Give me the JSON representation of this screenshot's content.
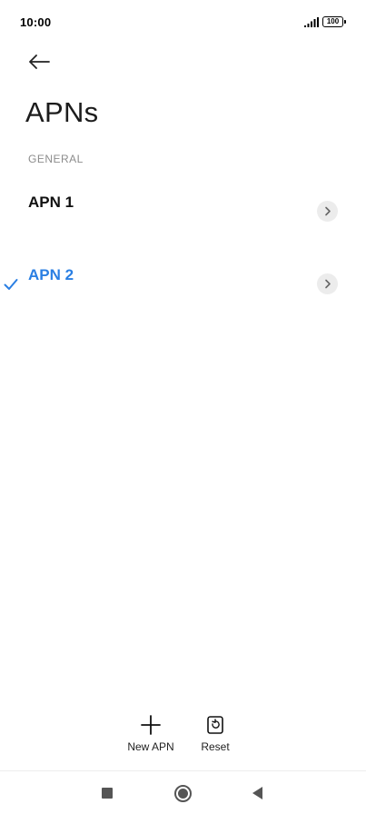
{
  "status_bar": {
    "time": "10:00",
    "battery": "100",
    "icons": [
      "signal-icon",
      "battery-icon"
    ]
  },
  "header": {
    "back_icon": "arrow-left-icon",
    "title": "APNs"
  },
  "sections": [
    {
      "header": "GENERAL",
      "items": [
        {
          "label": "APN 1",
          "selected": false
        },
        {
          "label": "APN 2",
          "selected": true
        }
      ]
    }
  ],
  "colors": {
    "accent": "#2a7fe3",
    "text_primary": "#111111",
    "text_secondary": "#8c8c8c",
    "chevron_bg": "#ececec"
  },
  "actions": {
    "new_apn_label": "New APN",
    "new_apn_icon": "plus-icon",
    "reset_label": "Reset",
    "reset_icon": "reset-icon"
  },
  "nav_bar": {
    "icons": [
      "recent-apps-icon",
      "home-icon",
      "back-triangle-icon"
    ]
  }
}
